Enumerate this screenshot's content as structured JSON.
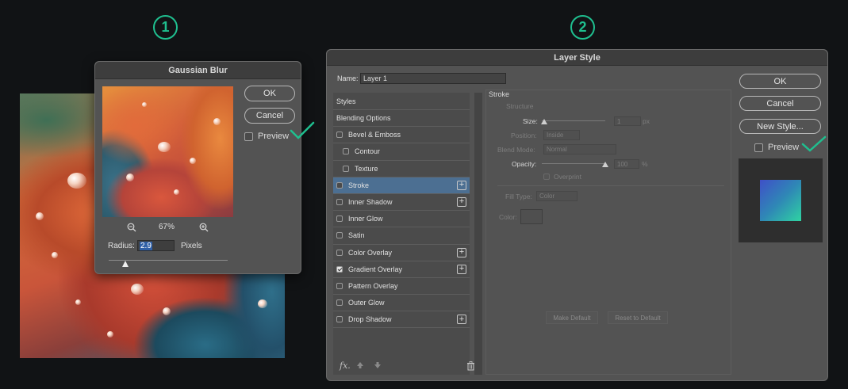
{
  "steps": [
    "1",
    "2"
  ],
  "colors": {
    "accent": "#1fbf8f",
    "selected_row": "#4c6f92",
    "dialog_bg": "#535353"
  },
  "gaussian_blur": {
    "title": "Gaussian Blur",
    "ok": "OK",
    "cancel": "Cancel",
    "preview_label": "Preview",
    "preview_checked": false,
    "zoom": "67%",
    "radius_label": "Radius:",
    "radius_value": "2.9",
    "unit": "Pixels",
    "icons": [
      "zoom-out-icon",
      "zoom-in-icon"
    ]
  },
  "layer_style": {
    "title": "Layer Style",
    "name_label": "Name:",
    "name_value": "Layer 1",
    "styles_header": "Styles",
    "items": [
      {
        "label": "Blending Options",
        "checkbox": false,
        "checked": false,
        "indent": 0,
        "plus": false,
        "selected": false
      },
      {
        "label": "Bevel & Emboss",
        "checkbox": true,
        "checked": false,
        "indent": 0,
        "plus": false,
        "selected": false
      },
      {
        "label": "Contour",
        "checkbox": true,
        "checked": false,
        "indent": 1,
        "plus": false,
        "selected": false
      },
      {
        "label": "Texture",
        "checkbox": true,
        "checked": false,
        "indent": 1,
        "plus": false,
        "selected": false
      },
      {
        "label": "Stroke",
        "checkbox": true,
        "checked": false,
        "indent": 0,
        "plus": true,
        "selected": true
      },
      {
        "label": "Inner Shadow",
        "checkbox": true,
        "checked": false,
        "indent": 0,
        "plus": true,
        "selected": false
      },
      {
        "label": "Inner Glow",
        "checkbox": true,
        "checked": false,
        "indent": 0,
        "plus": false,
        "selected": false
      },
      {
        "label": "Satin",
        "checkbox": true,
        "checked": false,
        "indent": 0,
        "plus": false,
        "selected": false
      },
      {
        "label": "Color Overlay",
        "checkbox": true,
        "checked": false,
        "indent": 0,
        "plus": true,
        "selected": false
      },
      {
        "label": "Gradient Overlay",
        "checkbox": true,
        "checked": true,
        "indent": 0,
        "plus": true,
        "selected": false
      },
      {
        "label": "Pattern Overlay",
        "checkbox": true,
        "checked": false,
        "indent": 0,
        "plus": false,
        "selected": false
      },
      {
        "label": "Outer Glow",
        "checkbox": true,
        "checked": false,
        "indent": 0,
        "plus": false,
        "selected": false
      },
      {
        "label": "Drop Shadow",
        "checkbox": true,
        "checked": false,
        "indent": 0,
        "plus": true,
        "selected": false
      }
    ],
    "stroke": {
      "title": "Stroke",
      "structure": "Structure",
      "size_label": "Size:",
      "size_value": "1",
      "size_unit": "px",
      "position_label": "Position:",
      "position_value": "Inside",
      "blend_label": "Blend Mode:",
      "blend_value": "Normal",
      "opacity_label": "Opacity:",
      "opacity_value": "100",
      "opacity_unit": "%",
      "overprint": "Overprint",
      "fill_type_label": "Fill Type:",
      "fill_type_value": "Color",
      "color_label": "Color:",
      "make_default": "Make Default",
      "reset_default": "Reset to Default"
    },
    "ok": "OK",
    "cancel": "Cancel",
    "new_style": "New Style...",
    "preview_label": "Preview",
    "preview_checked": false,
    "footer_fx": "fx."
  }
}
